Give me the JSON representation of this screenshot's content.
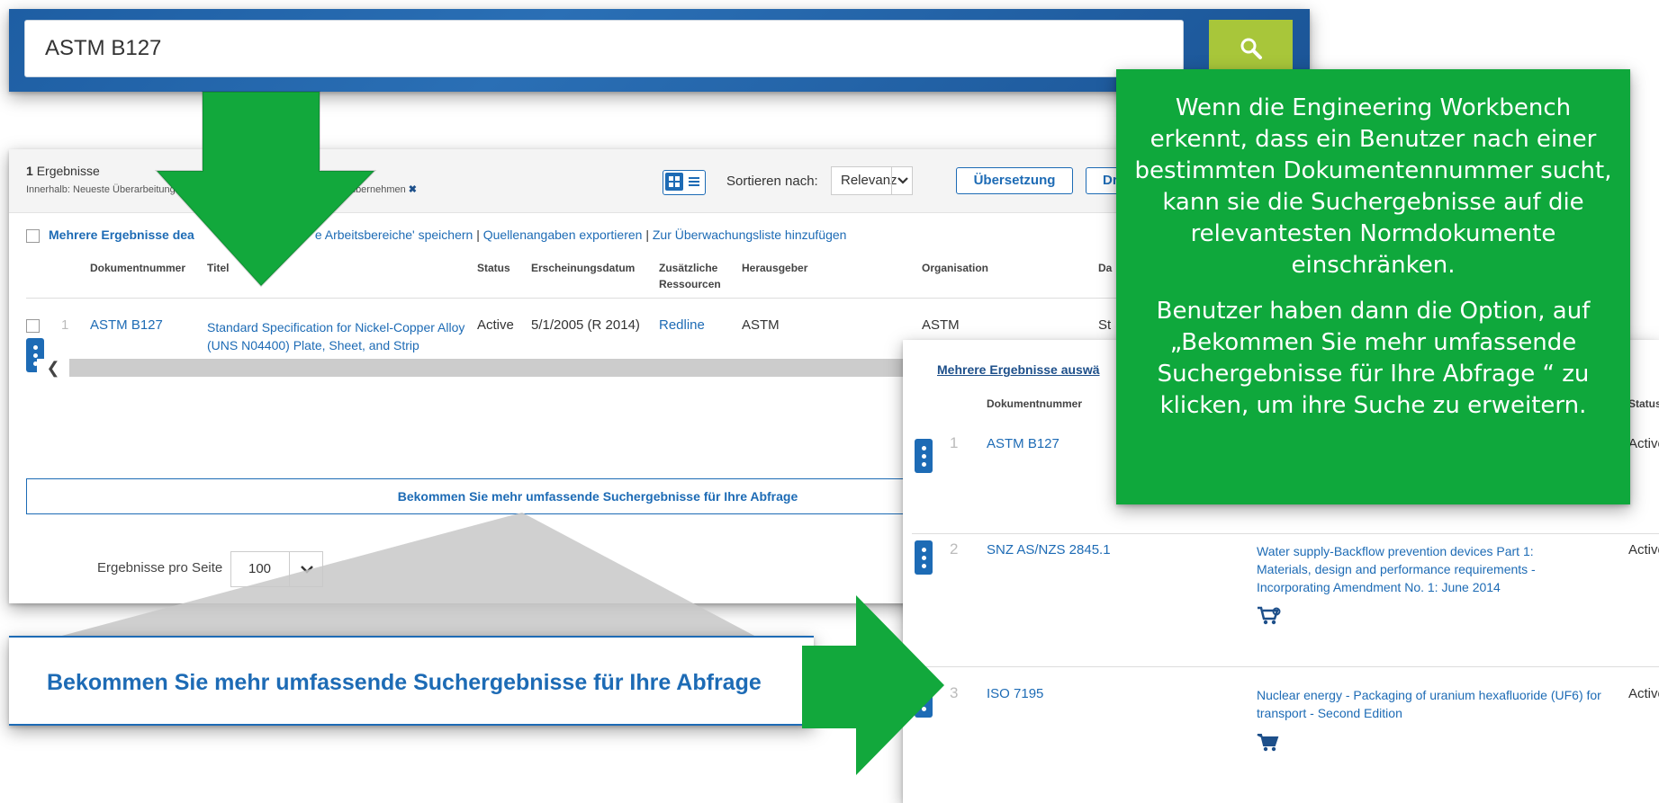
{
  "search": {
    "query": "ASTM B127",
    "button_icon": "search-icon"
  },
  "results": {
    "count": "1",
    "count_label": "Ergebnisse",
    "within_prefix": "Innerhalb:",
    "within_filter": "Neueste Überarbeitung",
    "within_filter2": "Überarbeitungsdaten übernehmen",
    "sort_label": "Sortieren nach:",
    "sort_value": "Relevanz",
    "translate_button": "Übersetzung",
    "second_button": "Dr",
    "actions": {
      "select_label": "Mehrere Ergebnisse dea",
      "save_workspaces": "e Arbeitsbereiche' speichern",
      "export_citations": "Quellenangaben exportieren",
      "add_watchlist": "Zur Überwachungsliste hinzufügen",
      "separator": "|"
    },
    "columns": {
      "doc_number": "Dokumentnummer",
      "title": "Titel",
      "status": "Status",
      "date": "Erscheinungsdatum",
      "resources_line1": "Zusätzliche",
      "resources_line2": "Ressourcen",
      "publisher": "Herausgeber",
      "organization": "Organisation",
      "date2": "Da"
    },
    "row": {
      "index": "1",
      "doc_number": "ASTM B127",
      "title": "Standard Specification for Nickel-Copper Alloy (UNS N04400) Plate, Sheet, and Strip",
      "status": "Active",
      "date": "5/1/2005 (R 2014)",
      "resources": "Redline",
      "publisher": "ASTM",
      "organization": "ASTM",
      "trailing": "St"
    },
    "scroll_left_icon": "chevron-left-icon",
    "more_results_button": "Bekommen Sie mehr umfassende Suchergebnisse für Ihre Abfrage",
    "per_page_label": "Ergebnisse pro Seite",
    "per_page_value": "100"
  },
  "zoom": {
    "button_label": "Bekommen Sie mehr umfassende Suchergebnisse für Ihre Abfrage"
  },
  "expanded": {
    "select_label": "Mehrere Ergebnisse auswä",
    "col_doc_number": "Dokumentnummer",
    "col_status": "Status",
    "rows": [
      {
        "index": "1",
        "doc_number": "ASTM B127",
        "title": "",
        "status": "Active"
      },
      {
        "index": "2",
        "doc_number": "SNZ AS/NZS 2845.1",
        "title": "Water supply-Backflow prevention devices Part 1: Materials, design and performance requirements - Incorporating Amendment No. 1: June 2014",
        "status": "Active"
      },
      {
        "index": "3",
        "doc_number": "ISO 7195",
        "title": "Nuclear energy - Packaging of uranium hexafluoride (UF6) for transport - Second Edition",
        "status": "Active"
      }
    ]
  },
  "callout": {
    "paragraph1": "Wenn die Engineering Workbench erkennt, dass ein Benutzer nach einer bestimmten Dokumentennummer sucht, kann sie die Suchergebnisse auf die relevantesten Normdokumente einschränken.",
    "paragraph2": "Benutzer haben dann die Option, auf „Bekommen Sie mehr umfassende Suchergebnisse für Ihre Abfrage “ zu klicken, um ihre Suche zu erweitern."
  },
  "colors": {
    "brand_blue": "#1d6bb5",
    "search_green": "#a8c63a",
    "callout_green": "#0fa83c",
    "arrow_green": "#12a83c"
  }
}
